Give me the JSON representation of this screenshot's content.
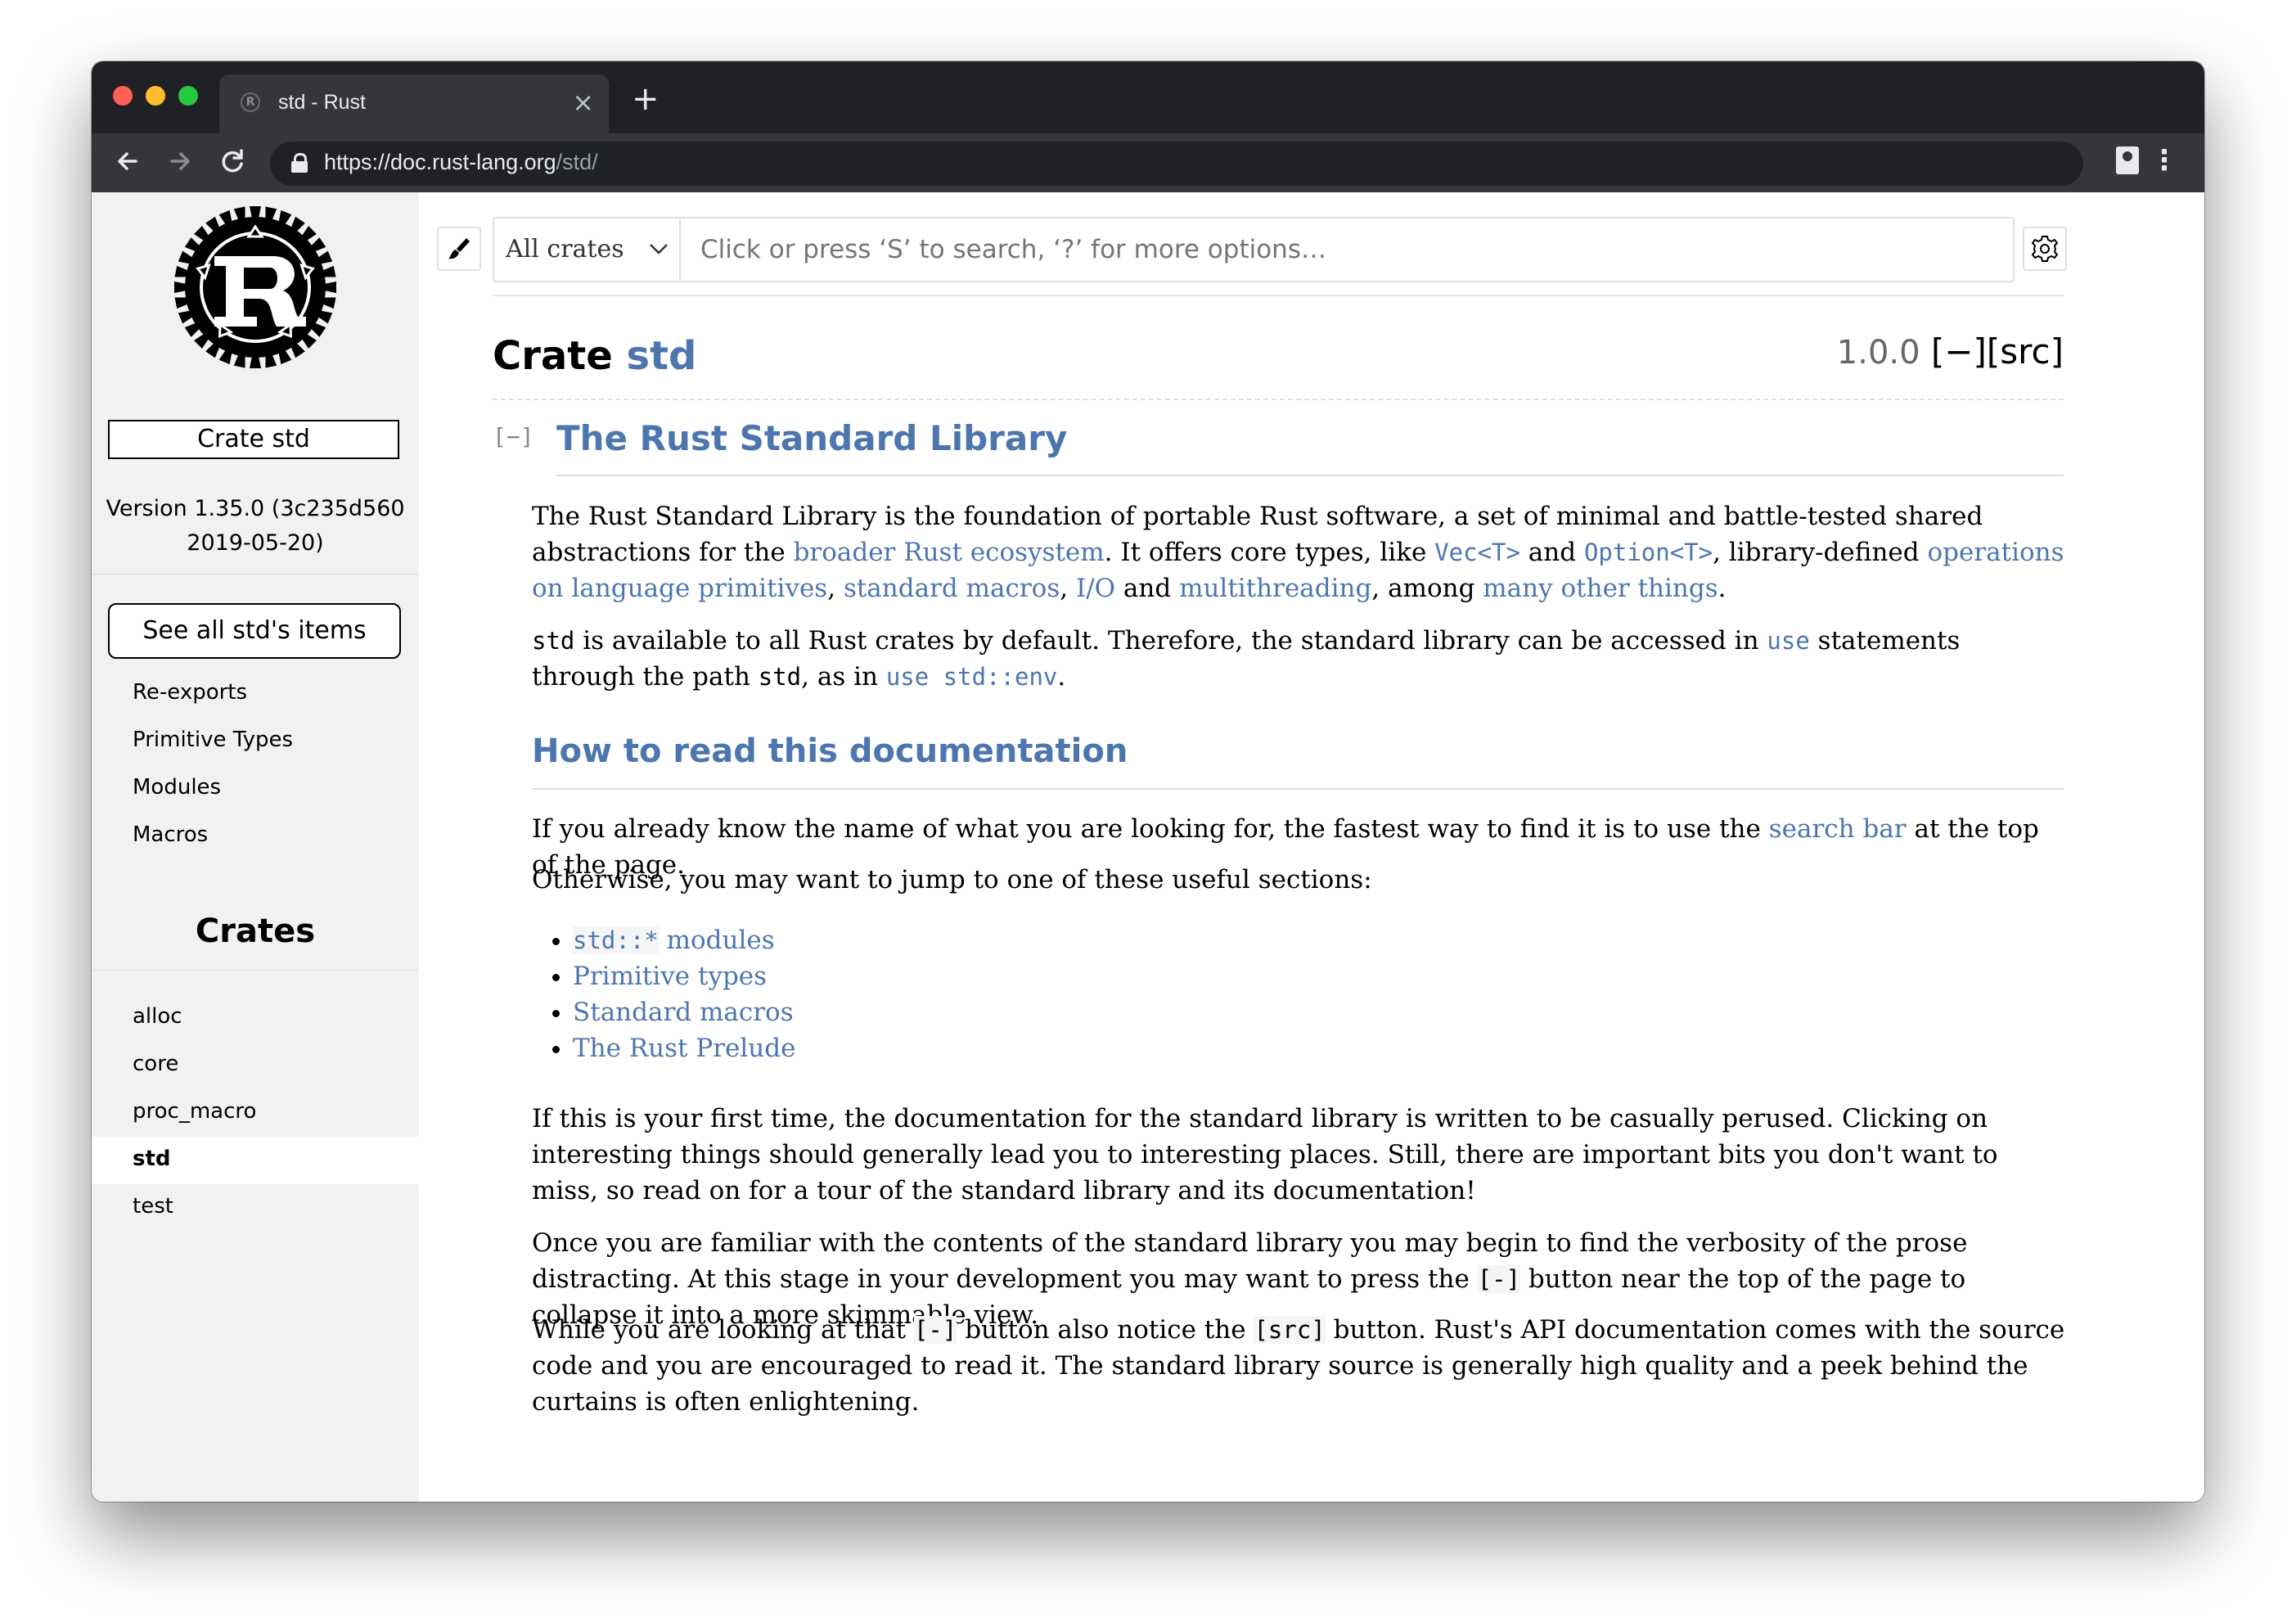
{
  "browser": {
    "tab_title": "std - Rust",
    "url_host": "https://doc.rust-lang.org",
    "url_path": "/std/"
  },
  "sidebar": {
    "crate_box": "Crate std",
    "version_line1": "Version 1.35.0 (3c235d560",
    "version_line2": "2019-05-20)",
    "see_all": "See all std's items",
    "sections": [
      "Re-exports",
      "Primitive Types",
      "Modules",
      "Macros"
    ],
    "crates_heading": "Crates",
    "crates": [
      "alloc",
      "core",
      "proc_macro",
      "std",
      "test"
    ],
    "current_crate": "std"
  },
  "search": {
    "crate_filter": "All crates",
    "placeholder": "Click or press ‘S’ to search, ‘?’ for more options…"
  },
  "header": {
    "kind": "Crate",
    "name": "std",
    "since": "1.0.0",
    "collapse": "[−]",
    "src": "[src]"
  },
  "doc": {
    "toggle": "[−]",
    "title": "The Rust Standard Library",
    "p1": {
      "t1": "The Rust Standard Library is the foundation of portable Rust software, a set of minimal and battle-tested shared abstractions for the ",
      "l1": "broader Rust ecosystem",
      "t2": ". It offers core types, like ",
      "c1": "Vec<T>",
      "t3": " and ",
      "c2": "Option<T>",
      "t4": ", library-defined ",
      "l2": "operations on language primitives",
      "t5": ", ",
      "l3": "standard macros",
      "t6": ", ",
      "l4": "I/O",
      "t7": " and ",
      "l5": "multithreading",
      "t8": ", among ",
      "l6": "many other things",
      "t9": "."
    },
    "p2": {
      "c1": "std",
      "t1": " is available to all Rust crates by default. Therefore, the standard library can be accessed in ",
      "c2": "use",
      "t2": " statements through the path ",
      "c3": "std",
      "t3": ", as in ",
      "c4": "use std::env",
      "t4": "."
    },
    "h2_read": "How to read this documentation",
    "p3": {
      "t1": "If you already know the name of what you are looking for, the fastest way to find it is to use the ",
      "l1": "search bar",
      "t2": " at the top of the page."
    },
    "p4": "Otherwise, you may want to jump to one of these useful sections:",
    "list": {
      "i1_code": "std::*",
      "i1_text": " modules",
      "i2": "Primitive types",
      "i3": "Standard macros",
      "i4": "The Rust Prelude"
    },
    "p5": "If this is your first time, the documentation for the standard library is written to be casually perused. Clicking on interesting things should generally lead you to interesting places. Still, there are important bits you don't want to miss, so read on for a tour of the standard library and its documentation!",
    "p6": {
      "t1": "Once you are familiar with the contents of the standard library you may begin to find the verbosity of the prose distracting. At this stage in your development you may want to press the ",
      "c1": "[-]",
      "t2": " button near the top of the page to collapse it into a more skimmable view."
    },
    "p7": {
      "t1": "While you are looking at that ",
      "c1": "[-]",
      "t2": " button also notice the ",
      "c2": "[src]",
      "t3": " button. Rust's API documentation comes with the source code and you are encouraged to read it. The standard library source is generally high quality and a peek behind the curtains is often enlightening."
    }
  },
  "colors": {
    "link": "#4d76ae",
    "sidebar_bg": "#f1f1f1",
    "chrome_dark": "#202124",
    "chrome_mid": "#35363a"
  },
  "icons": [
    "rust-logo-icon",
    "paintbrush-icon",
    "gear-icon",
    "chevron-down-icon",
    "lock-icon",
    "back-arrow-icon",
    "forward-arrow-icon",
    "reload-icon",
    "close-icon",
    "plus-icon",
    "extension-icon",
    "menu-dots-icon"
  ]
}
